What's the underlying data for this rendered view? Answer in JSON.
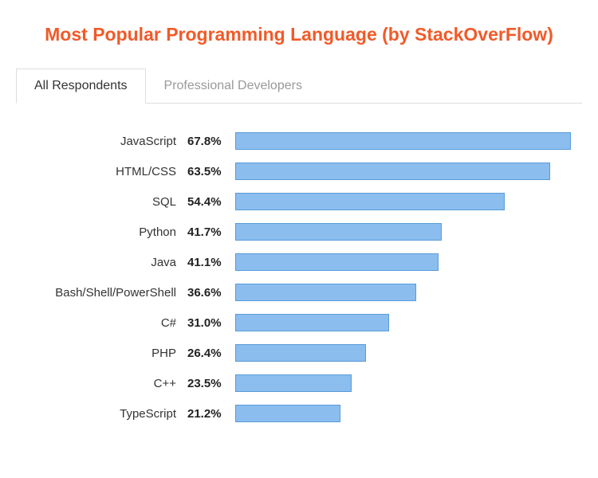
{
  "title": "Most Popular Programming Language (by StackOverFlow)",
  "tabs": [
    {
      "label": "All Respondents",
      "active": true
    },
    {
      "label": "Professional Developers",
      "active": false
    }
  ],
  "chart_data": {
    "type": "bar",
    "orientation": "horizontal",
    "title": "Most Popular Programming Language (by StackOverFlow)",
    "xlabel": "",
    "ylabel": "",
    "xlim": [
      0,
      70
    ],
    "categories": [
      "JavaScript",
      "HTML/CSS",
      "SQL",
      "Python",
      "Java",
      "Bash/Shell/PowerShell",
      "C#",
      "PHP",
      "C++",
      "TypeScript"
    ],
    "values": [
      67.8,
      63.5,
      54.4,
      41.7,
      41.1,
      36.6,
      31.0,
      26.4,
      23.5,
      21.2
    ],
    "value_suffix": "%"
  },
  "colors": {
    "accent": "#f15a29",
    "bar_fill": "#8bbdef",
    "bar_border": "#5a9bd8"
  }
}
